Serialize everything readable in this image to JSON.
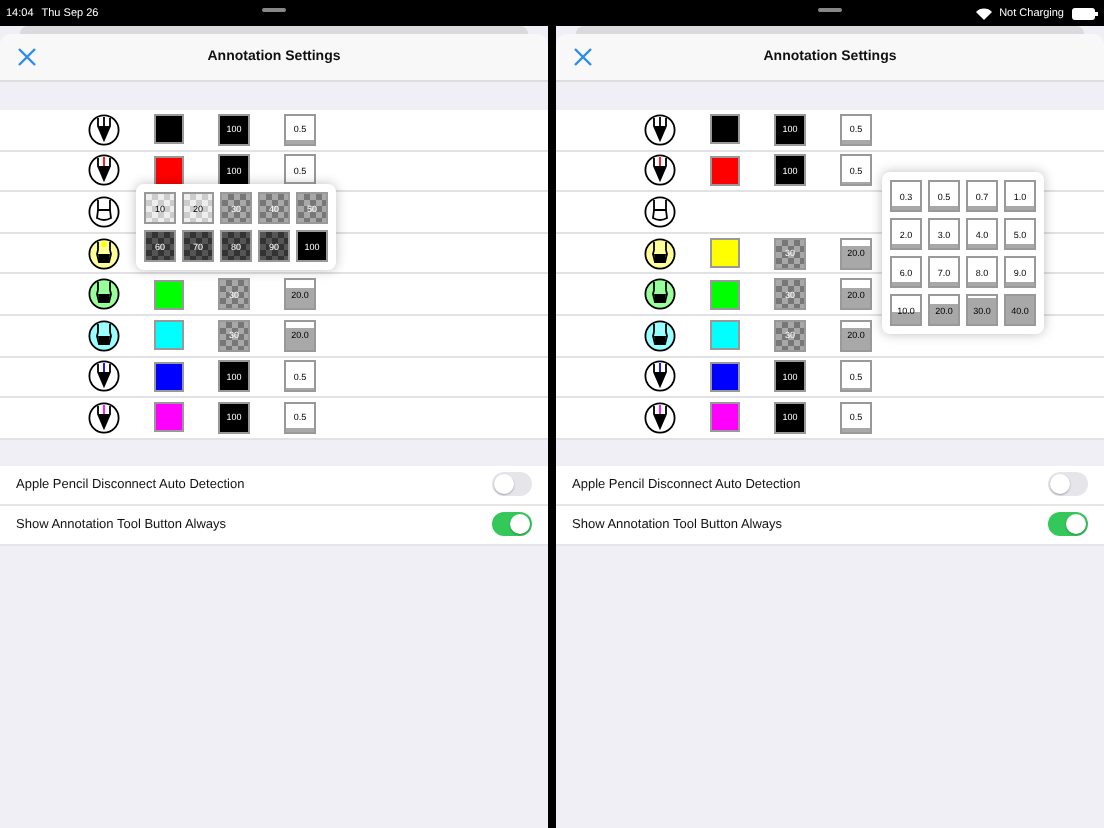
{
  "status_bar": {
    "time": "14:04",
    "date": "Thu Sep 26",
    "charging": "Not Charging"
  },
  "panes": [
    {
      "title": "Annotation Settings",
      "tools": [
        {
          "kind": "pen",
          "color": "#000000",
          "opacity": {
            "text": "100",
            "kind": "solid"
          },
          "width": {
            "text": "0.5",
            "kind": "thin"
          }
        },
        {
          "kind": "pen",
          "color": "#ff0000",
          "opacity": {
            "text": "100",
            "kind": "solid"
          },
          "width": {
            "text": "0.5",
            "kind": "thin"
          }
        },
        {
          "kind": "eraser"
        },
        {
          "kind": "highlighter",
          "color": "#ffff00"
        },
        {
          "kind": "highlighter",
          "color": "#00ff00",
          "opacity": {
            "text": "30",
            "kind": "checkered"
          },
          "width": {
            "text": "20.0",
            "kind": "high"
          }
        },
        {
          "kind": "highlighter",
          "color": "#00ffff",
          "opacity": {
            "text": "30",
            "kind": "checkered"
          },
          "width": {
            "text": "20.0",
            "kind": "high"
          }
        },
        {
          "kind": "pen",
          "color": "#0000ff",
          "opacity": {
            "text": "100",
            "kind": "solid"
          },
          "width": {
            "text": "0.5",
            "kind": "thin"
          }
        },
        {
          "kind": "pen",
          "color": "#ff00ff",
          "opacity": {
            "text": "100",
            "kind": "solid"
          },
          "width": {
            "text": "0.5",
            "kind": "thin"
          }
        }
      ],
      "popup": {
        "kind": "opacity",
        "options": [
          {
            "text": "10",
            "kind": "light"
          },
          {
            "text": "20",
            "kind": "light"
          },
          {
            "text": "30",
            "kind": "checkered"
          },
          {
            "text": "40",
            "kind": "checkered"
          },
          {
            "text": "50",
            "kind": "checkered"
          },
          {
            "text": "60",
            "kind": "dark"
          },
          {
            "text": "70",
            "kind": "dark"
          },
          {
            "text": "80",
            "kind": "dark"
          },
          {
            "text": "90",
            "kind": "dark"
          },
          {
            "text": "100",
            "kind": "solid"
          }
        ]
      },
      "settings": [
        {
          "label": "Apple Pencil Disconnect Auto Detection",
          "on": false
        },
        {
          "label": "Show Annotation Tool Button Always",
          "on": true
        }
      ]
    },
    {
      "title": "Annotation Settings",
      "tools": [
        {
          "kind": "pen",
          "color": "#000000",
          "opacity": {
            "text": "100",
            "kind": "solid"
          },
          "width": {
            "text": "0.5",
            "kind": "thin"
          }
        },
        {
          "kind": "pen",
          "color": "#ff0000",
          "opacity": {
            "text": "100",
            "kind": "solid"
          },
          "width": {
            "text": "0.5",
            "kind": "thin"
          }
        },
        {
          "kind": "eraser"
        },
        {
          "kind": "highlighter",
          "color": "#ffff00",
          "opacity": {
            "text": "30",
            "kind": "checkered"
          },
          "width": {
            "text": "20.0",
            "kind": "high"
          }
        },
        {
          "kind": "highlighter",
          "color": "#00ff00",
          "opacity": {
            "text": "30",
            "kind": "checkered"
          },
          "width": {
            "text": "20.0",
            "kind": "high"
          }
        },
        {
          "kind": "highlighter",
          "color": "#00ffff",
          "opacity": {
            "text": "30",
            "kind": "checkered"
          },
          "width": {
            "text": "20.0",
            "kind": "high"
          }
        },
        {
          "kind": "pen",
          "color": "#0000ff",
          "opacity": {
            "text": "100",
            "kind": "solid"
          },
          "width": {
            "text": "0.5",
            "kind": "thin"
          }
        },
        {
          "kind": "pen",
          "color": "#ff00ff",
          "opacity": {
            "text": "100",
            "kind": "solid"
          },
          "width": {
            "text": "0.5",
            "kind": "thin"
          }
        }
      ],
      "popup": {
        "kind": "width",
        "options": [
          {
            "text": "0.3",
            "kind": "thin"
          },
          {
            "text": "0.5",
            "kind": "thin"
          },
          {
            "text": "0.7",
            "kind": "thin"
          },
          {
            "text": "1.0",
            "kind": "thin"
          },
          {
            "text": "2.0",
            "kind": "thin"
          },
          {
            "text": "3.0",
            "kind": "thin"
          },
          {
            "text": "4.0",
            "kind": "thin"
          },
          {
            "text": "5.0",
            "kind": "thin"
          },
          {
            "text": "6.0",
            "kind": "thin"
          },
          {
            "text": "7.0",
            "kind": "thin"
          },
          {
            "text": "8.0",
            "kind": "thin"
          },
          {
            "text": "9.0",
            "kind": "thin"
          },
          {
            "text": "10.0",
            "kind": "half"
          },
          {
            "text": "20.0",
            "kind": "high"
          },
          {
            "text": "30.0",
            "kind": "higher"
          },
          {
            "text": "40.0",
            "kind": "full"
          }
        ]
      },
      "settings": [
        {
          "label": "Apple Pencil Disconnect Auto Detection",
          "on": false
        },
        {
          "label": "Show Annotation Tool Button Always",
          "on": true
        }
      ]
    }
  ]
}
